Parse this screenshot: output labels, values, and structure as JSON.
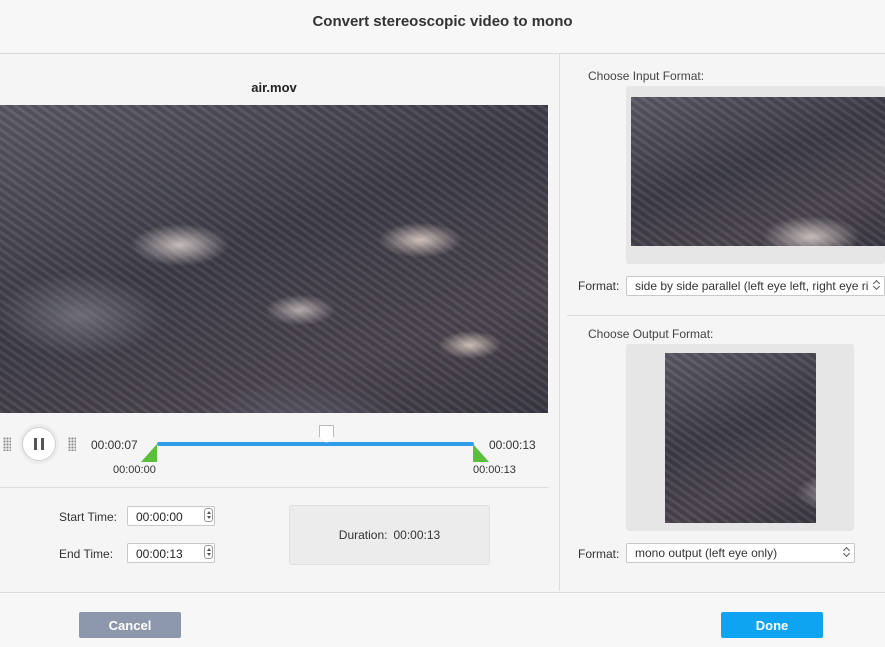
{
  "dialog": {
    "title": "Convert stereoscopic video to mono"
  },
  "player": {
    "file_name": "air.mov",
    "current_time": "00:00:07",
    "end_time_label": "00:00:13",
    "range_start": "00:00:00",
    "range_end": "00:00:13"
  },
  "trim": {
    "start_label": "Start Time:",
    "start_value": "00:00:00",
    "end_label": "End Time:",
    "end_value": "00:00:13",
    "duration_label": "Duration:",
    "duration_value": "00:00:13"
  },
  "input": {
    "section_label": "Choose Input Format:",
    "format_label": "Format:",
    "format_value": "side by side parallel (left eye left, right eye ri"
  },
  "output": {
    "section_label": "Choose Output Format:",
    "format_label": "Format:",
    "format_value": "mono output (left eye only)"
  },
  "footer": {
    "cancel_label": "Cancel",
    "done_label": "Done"
  },
  "colors": {
    "accent": "#0ea4f2",
    "track": "#2f9ee8",
    "handle": "#5bbf3c",
    "cancel": "#8d97ab"
  },
  "icons": [
    "pause-icon",
    "grip-icon",
    "spinner-icon",
    "chevron-updown-icon",
    "playhead-icon"
  ]
}
